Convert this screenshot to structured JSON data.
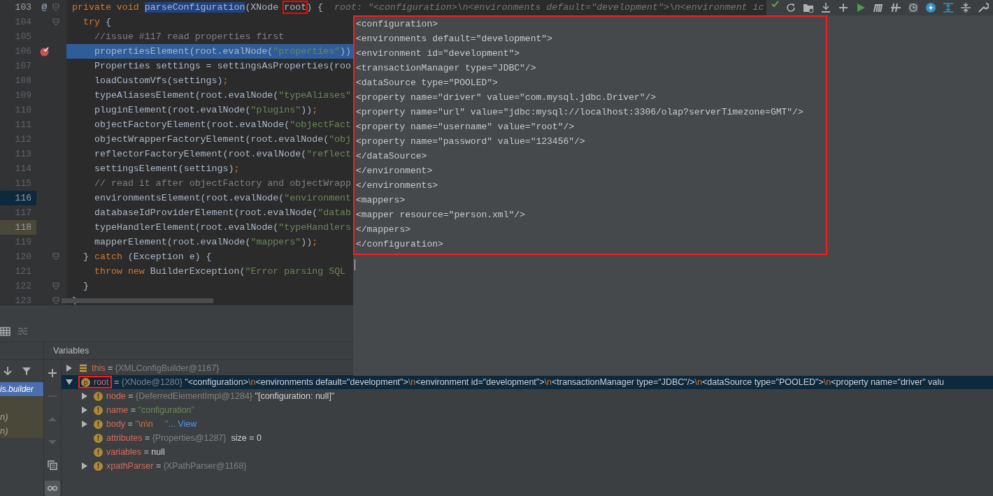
{
  "editor": {
    "lines": [
      {
        "number": "103",
        "current": true,
        "selected": false,
        "breakpoint": false,
        "marker": "@",
        "fold": true,
        "parts": [
          {
            "kind": "kw",
            "text": "private void "
          },
          {
            "kind": "hl",
            "text": "parseConfiguration"
          },
          {
            "kind": "plain",
            "text": "(XNode "
          },
          {
            "kind": "boxed",
            "text": "root"
          },
          {
            "kind": "plain",
            "text": ") {"
          }
        ],
        "hint": "root: \"<configuration>\\n<environments default=\"development\">\\n<environment ic",
        "children": [
          {
            "number": "104",
            "current": false,
            "selected": false,
            "breakpoint": false,
            "fold": true,
            "parts": [
              {
                "kind": "kw",
                "text": "try"
              },
              {
                "kind": "plain",
                "text": " {"
              }
            ],
            "children": [
              {
                "number": "105",
                "current": false,
                "selected": false,
                "breakpoint": false,
                "fold": false,
                "parts": [
                  {
                    "kind": "comment",
                    "text": "//issue #117 read properties first"
                  }
                ]
              },
              {
                "number": "106",
                "current": false,
                "selected": true,
                "breakpoint": true,
                "fold": false,
                "parts": [
                  {
                    "kind": "plain",
                    "text": "propertiesElement(root.evalNode("
                  },
                  {
                    "kind": "str",
                    "text": "\"properties\""
                  },
                  {
                    "kind": "plain",
                    "text": "))"
                  }
                ]
              },
              {
                "number": "107",
                "current": false,
                "selected": false,
                "breakpoint": false,
                "fold": false,
                "parts": [
                  {
                    "kind": "plain",
                    "text": "Properties settings = settingsAsProperties(roo"
                  }
                ]
              },
              {
                "number": "108",
                "current": false,
                "selected": false,
                "breakpoint": false,
                "fold": false,
                "parts": [
                  {
                    "kind": "plain",
                    "text": "loadCustomVfs(settings)"
                  },
                  {
                    "kind": "semi",
                    "text": ";"
                  }
                ]
              },
              {
                "number": "109",
                "current": false,
                "selected": false,
                "breakpoint": false,
                "fold": false,
                "parts": [
                  {
                    "kind": "plain",
                    "text": "typeAliasesElement(root.evalNode("
                  },
                  {
                    "kind": "str",
                    "text": "\"typeAliases\""
                  }
                ]
              },
              {
                "number": "110",
                "current": false,
                "selected": false,
                "breakpoint": false,
                "fold": false,
                "parts": [
                  {
                    "kind": "plain",
                    "text": "pluginElement(root.evalNode("
                  },
                  {
                    "kind": "str",
                    "text": "\"plugins\""
                  },
                  {
                    "kind": "plain",
                    "text": "))"
                  },
                  {
                    "kind": "semi",
                    "text": ";"
                  }
                ]
              },
              {
                "number": "111",
                "current": false,
                "selected": false,
                "breakpoint": false,
                "fold": false,
                "parts": [
                  {
                    "kind": "plain",
                    "text": "objectFactoryElement(root.evalNode("
                  },
                  {
                    "kind": "str",
                    "text": "\"objectFact"
                  }
                ]
              },
              {
                "number": "112",
                "current": false,
                "selected": false,
                "breakpoint": false,
                "fold": false,
                "parts": [
                  {
                    "kind": "plain",
                    "text": "objectWrapperFactoryElement(root.evalNode("
                  },
                  {
                    "kind": "str",
                    "text": "\"obj"
                  }
                ]
              },
              {
                "number": "113",
                "current": false,
                "selected": false,
                "breakpoint": false,
                "fold": false,
                "parts": [
                  {
                    "kind": "plain",
                    "text": "reflectorFactoryElement(root.evalNode("
                  },
                  {
                    "kind": "str",
                    "text": "\"reflect"
                  }
                ]
              },
              {
                "number": "114",
                "current": false,
                "selected": false,
                "breakpoint": false,
                "fold": false,
                "parts": [
                  {
                    "kind": "plain",
                    "text": "settingsElement(settings)"
                  },
                  {
                    "kind": "semi",
                    "text": ";"
                  }
                ]
              },
              {
                "number": "115",
                "current": false,
                "selected": false,
                "breakpoint": false,
                "fold": false,
                "parts": [
                  {
                    "kind": "comment",
                    "text": "// read it after objectFactory and objectWrapp"
                  }
                ]
              },
              {
                "number": "116",
                "current": false,
                "selected": false,
                "breakpoint": false,
                "fold": false,
                "color": "#0d293e",
                "parts": [
                  {
                    "kind": "plain",
                    "text": "environmentsElement(root.evalNode("
                  },
                  {
                    "kind": "str",
                    "text": "\"environment"
                  }
                ]
              },
              {
                "number": "117",
                "current": false,
                "selected": false,
                "breakpoint": false,
                "fold": false,
                "parts": [
                  {
                    "kind": "plain",
                    "text": "databaseIdProviderElement(root.evalNode("
                  },
                  {
                    "kind": "str",
                    "text": "\"datab"
                  }
                ]
              },
              {
                "number": "118",
                "current": false,
                "selected": false,
                "breakpoint": false,
                "fold": false,
                "color": "#4a4838",
                "parts": [
                  {
                    "kind": "plain",
                    "text": "typeHandlerElement(root.evalNode("
                  },
                  {
                    "kind": "str",
                    "text": "\"typeHandlers"
                  }
                ]
              },
              {
                "number": "119",
                "current": false,
                "selected": false,
                "breakpoint": false,
                "fold": false,
                "parts": [
                  {
                    "kind": "plain",
                    "text": "mapperElement(root.evalNode("
                  },
                  {
                    "kind": "str",
                    "text": "\"mappers\""
                  },
                  {
                    "kind": "plain",
                    "text": "))"
                  },
                  {
                    "kind": "semi",
                    "text": ";"
                  }
                ]
              }
            ]
          },
          {
            "number": "120",
            "current": false,
            "selected": false,
            "breakpoint": false,
            "fold": true,
            "parts": [
              {
                "kind": "plain",
                "text": "} "
              },
              {
                "kind": "kw",
                "text": "catch"
              },
              {
                "kind": "plain",
                "text": " (Exception e) {"
              }
            ],
            "children": [
              {
                "number": "121",
                "current": false,
                "selected": false,
                "breakpoint": false,
                "fold": false,
                "parts": [
                  {
                    "kind": "kw",
                    "text": "throw new"
                  },
                  {
                    "kind": "plain",
                    "text": " BuilderException("
                  },
                  {
                    "kind": "str",
                    "text": "\"Error parsing SQL"
                  }
                ]
              }
            ]
          },
          {
            "number": "122",
            "current": false,
            "selected": false,
            "breakpoint": false,
            "fold": true,
            "parts": [
              {
                "kind": "plain",
                "text": "}"
              }
            ]
          }
        ]
      },
      {
        "number": "123",
        "current": false,
        "selected": false,
        "breakpoint": false,
        "fold": true,
        "parts": [
          {
            "kind": "plain",
            "text": "}"
          }
        ]
      }
    ]
  },
  "toolbar": [
    {
      "kind": "check"
    },
    {
      "kind": "refresh"
    },
    {
      "kind": "folder"
    },
    {
      "kind": "download"
    },
    {
      "kind": "plus"
    },
    {
      "kind": "run"
    },
    {
      "kind": "m"
    },
    {
      "kind": "slash"
    },
    {
      "kind": "clock"
    },
    {
      "kind": "bolt"
    },
    {
      "kind": "expand"
    },
    {
      "kind": "collapse"
    },
    {
      "kind": "wrench"
    }
  ],
  "popup": {
    "outlined": true,
    "lines": [
      "<configuration>",
      "<environments default=\"development\">",
      "<environment id=\"development\">",
      "<transactionManager type=\"JDBC\"/>",
      "<dataSource type=\"POOLED\">",
      "<property name=\"driver\" value=\"com.mysql.jdbc.Driver\"/>",
      "<property name=\"url\" value=\"jdbc:mysql://localhost:3306/olap?serverTimezone=GMT\"/>",
      "<property name=\"username\" value=\"root\"/>",
      "<property name=\"password\" value=\"123456\"/>",
      "</dataSource>",
      "</environment>",
      "</environments>",
      "<mappers>",
      "<mapper resource=\"person.xml\"/>",
      "</mappers>",
      "</configuration>"
    ]
  },
  "debug": {
    "tab_icons": [
      {
        "kind": "table",
        "disabled": false
      },
      {
        "kind": "layout",
        "disabled": true
      }
    ],
    "frames_toolbar": [
      {
        "kind": "down"
      },
      {
        "kind": "filter"
      }
    ],
    "frames": [
      {
        "label": "is.builder",
        "selected": true
      },
      {
        "label": "n)",
        "selected": false
      },
      {
        "label": "n)",
        "selected": false
      }
    ],
    "variables_title": "Variables",
    "var_toolbar": [
      {
        "kind": "plus",
        "disabled": false,
        "selected": false
      },
      {
        "kind": "minus",
        "disabled": true,
        "selected": false
      },
      {
        "kind": "up",
        "disabled": true,
        "selected": false
      },
      {
        "kind": "down",
        "disabled": true,
        "selected": false
      },
      {
        "kind": "copy",
        "disabled": false,
        "selected": false
      },
      {
        "kind": "glasses",
        "disabled": false,
        "selected": true
      }
    ],
    "variables": [
      {
        "kind": "object",
        "name": "this",
        "expandable": true,
        "expanded": false,
        "selected": false,
        "value": [
          {
            "kind": "op",
            "text": " = "
          },
          {
            "kind": "ref",
            "text": "{XMLConfigBuilder@1167}"
          }
        ]
      },
      {
        "kind": "marked_field",
        "badge": "p",
        "name": "root",
        "expandable": true,
        "expanded": true,
        "selected": true,
        "value": [
          {
            "kind": "op",
            "text": " = "
          },
          {
            "kind": "ref",
            "text": "{XNode@1280}"
          },
          {
            "kind": "str",
            "text": " \"<configuration>"
          },
          {
            "kind": "esc",
            "text": "\\n"
          },
          {
            "kind": "str",
            "text": "<environments default=\"development\">"
          },
          {
            "kind": "esc",
            "text": "\\n"
          },
          {
            "kind": "str",
            "text": "<environment id=\"development\">"
          },
          {
            "kind": "esc",
            "text": "\\n"
          },
          {
            "kind": "str",
            "text": "<transactionManager type=\"JDBC\"/>"
          },
          {
            "kind": "esc",
            "text": "\\n"
          },
          {
            "kind": "str",
            "text": "<dataSource type=\"POOLED\">"
          },
          {
            "kind": "esc",
            "text": "\\n"
          },
          {
            "kind": "str",
            "text": "<property name=\"driver\" valu"
          }
        ],
        "children": [
          {
            "kind": "field",
            "badge": "f",
            "name": "node",
            "expandable": true,
            "expanded": false,
            "selected": false,
            "value": [
              {
                "kind": "op",
                "text": " = "
              },
              {
                "kind": "ref",
                "text": "{DeferredElementImpl@1284}"
              },
              {
                "kind": "str",
                "text": " \"[configuration: null]\""
              }
            ]
          },
          {
            "kind": "field",
            "badge": "f",
            "name": "name",
            "expandable": true,
            "expanded": false,
            "selected": false,
            "value": [
              {
                "kind": "op",
                "text": " = "
              },
              {
                "kind": "green",
                "text": "\"configuration\""
              }
            ]
          },
          {
            "kind": "field",
            "badge": "f",
            "name": "body",
            "expandable": true,
            "expanded": false,
            "selected": false,
            "value": [
              {
                "kind": "op",
                "text": " = "
              },
              {
                "kind": "green",
                "text": "\""
              },
              {
                "kind": "esc",
                "text": "\\n\\n"
              },
              {
                "kind": "green",
                "text": "     \""
              },
              {
                "kind": "link",
                "text": "... View"
              }
            ]
          },
          {
            "kind": "field",
            "badge": "f",
            "name": "attributes",
            "expandable": false,
            "selected": false,
            "value": [
              {
                "kind": "op",
                "text": " = "
              },
              {
                "kind": "ref",
                "text": "{Properties@1287}"
              },
              {
                "kind": "str",
                "text": "  size = 0"
              }
            ]
          },
          {
            "kind": "field",
            "badge": "f",
            "name": "variables",
            "expandable": false,
            "selected": false,
            "value": [
              {
                "kind": "op",
                "text": " = "
              },
              {
                "kind": "str",
                "text": "null"
              }
            ]
          },
          {
            "kind": "field",
            "badge": "f",
            "name": "xpathParser",
            "expandable": true,
            "expanded": false,
            "selected": false,
            "value": [
              {
                "kind": "op",
                "text": " = "
              },
              {
                "kind": "ref",
                "text": "{XPathParser@1168}"
              }
            ]
          }
        ]
      }
    ]
  }
}
